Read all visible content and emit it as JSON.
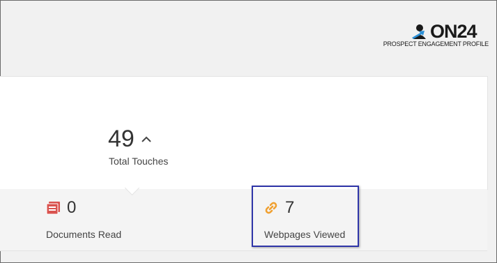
{
  "brand": {
    "name": "ON24",
    "subtitle": "PROSPECT ENGAGEMENT PROFILE",
    "colors": {
      "logo": "#1a1a1a",
      "accent": "#2b8fd6"
    }
  },
  "summary": {
    "total_touches_value": "49",
    "total_touches_label": "Total Touches",
    "trend_icon": "chevron-up-icon"
  },
  "stats": [
    {
      "name": "documents-read",
      "icon": "document-icon",
      "icon_color": "#d9534f",
      "value": "0",
      "label": "Documents Read"
    },
    {
      "name": "webpages-viewed",
      "icon": "link-icon",
      "icon_color": "#f0a030",
      "value": "7",
      "label": "Webpages Viewed",
      "highlighted": true
    }
  ],
  "highlight_color": "#2f35a8"
}
